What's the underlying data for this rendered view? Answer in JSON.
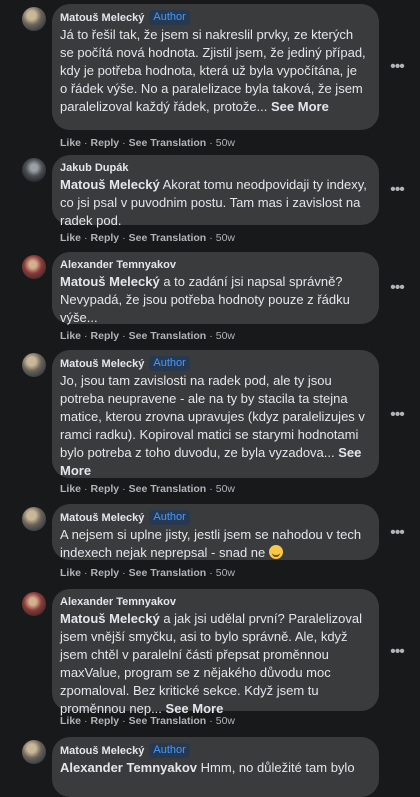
{
  "comments": [
    {
      "author": "Matouš Melecký",
      "badge": "Author",
      "text": "Já to řešil tak, že jsem si nakreslil prvky, ze kterých se počítá nová hodnota. Zjistil jsem, že jediný případ, kdy je potřeba hodnota, která už byla vypočítána, je o řádek výše. No a paralelizace byla taková, že jsem paralelizoval každý řádek, protože...",
      "see_more": "See More",
      "time": "50w"
    },
    {
      "author": "Jakub Dupák",
      "mention": "Matouš Melecký",
      "text": " Akorat tomu neodpovidaji ty indexy, co jsi psal v puvodnim postu. Tam mas i zavislost na radek pod.",
      "time": "50w"
    },
    {
      "author": "Alexander Temnyakov",
      "mention": "Matouš Melecký",
      "text": " a to zadání jsi napsal správně? Nevypadá, že jsou potřeba hodnoty pouze z řádku výše...",
      "time": "50w"
    },
    {
      "author": "Matouš Melecký",
      "badge": "Author",
      "text": "Jo, jsou tam zavislosti na radek pod, ale ty jsou potreba neupravene - ale na ty by stacila ta stejna matice, kterou zrovna upravujes (kdyz paralelizujes v ramci radku). Kopiroval matici se starymi hodnotami bylo potreba z toho duvodu, ze byla vyzadova...",
      "see_more": "See More",
      "time": "50w"
    },
    {
      "author": "Matouš Melecký",
      "badge": "Author",
      "text": "A nejsem si uplne jisty, jestli jsem se nahodou v tech indexech nejak neprepsal - snad ne",
      "emoji": "slightly-smiling-face",
      "time": "50w"
    },
    {
      "author": "Alexander Temnyakov",
      "mention": "Matouš Melecký",
      "text": " a jak jsi udělal první? Paralelizoval jsem vnější smyčku, asi to bylo správně. Ale, když jsem chtěl v paralelní části přepsat proměnnou maxValue, program se z nějakého důvodu moc zpomaloval. Bez kritické sekce. Když jsem tu proměnnou nep...",
      "see_more": "See More",
      "time": "50w"
    },
    {
      "author": "Matouš Melecký",
      "badge": "Author",
      "mention": "Alexander Temnyakov",
      "text": " Hmm, no důležité tam bylo"
    }
  ],
  "actions": {
    "like": "Like",
    "reply": "Reply",
    "see_translation": "See Translation",
    "dot": "·"
  },
  "icons": {
    "more": "more-horizontal-icon"
  }
}
